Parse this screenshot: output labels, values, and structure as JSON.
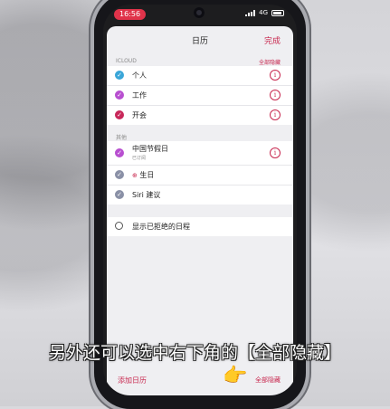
{
  "status_bar": {
    "time": "16:56",
    "network": "4G"
  },
  "nav": {
    "title": "日历",
    "done_label": "完成"
  },
  "icloud_section": {
    "header": "ICLOUD",
    "hide_all_label": "全部隐藏"
  },
  "icloud_calendars": [
    {
      "label": "个人",
      "color": "#3aa6d8",
      "checked": true
    },
    {
      "label": "工作",
      "color": "#b84fd0",
      "checked": true
    },
    {
      "label": "开会",
      "color": "#c8285a",
      "checked": true
    }
  ],
  "other_section": {
    "header": "其他"
  },
  "other_calendars": [
    {
      "label": "中国节假日",
      "sublabel": "已订阅",
      "color": "#b84fd0",
      "checked": true
    },
    {
      "label": "生日",
      "color": "#8a90a6",
      "checked": true
    },
    {
      "label": "Siri 建议",
      "color": "#8a90a6",
      "checked": true
    }
  ],
  "declined": {
    "label": "显示已拒绝的日程"
  },
  "toolbar": {
    "add_label": "添加日历",
    "hide_all_label": "全部隐藏"
  },
  "caption": "另外还可以选中右下角的【全部隐藏】",
  "colors": {
    "accent": "#c8284f"
  },
  "icons": {
    "info": "info-icon",
    "check": "checkmark-icon",
    "birthday": "gift-icon",
    "pointer": "pointing-hand-icon"
  }
}
